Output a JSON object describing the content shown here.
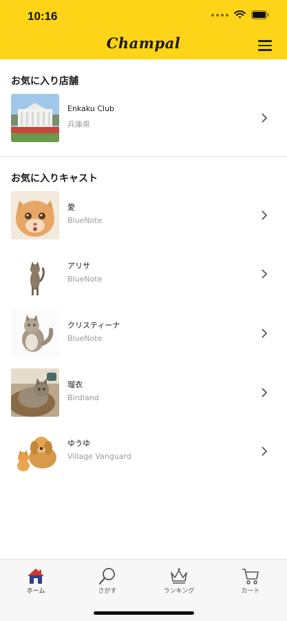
{
  "status": {
    "time": "10:16"
  },
  "header": {
    "logo": "Champal"
  },
  "stores": {
    "title": "お気に入り店舗",
    "items": [
      {
        "name": "Enkaku Club",
        "sub": "兵庫県",
        "image": "white-house-photo"
      }
    ]
  },
  "casts": {
    "title": "お気に入りキャスト",
    "items": [
      {
        "name": "愛",
        "sub": "BlueNote",
        "image": "orange-kitten-photo"
      },
      {
        "name": "アリサ",
        "sub": "BlueNote",
        "image": "standing-kitten-photo"
      },
      {
        "name": "クリスティーナ",
        "sub": "BlueNote",
        "image": "grey-fluffy-cat-photo"
      },
      {
        "name": "瑠衣",
        "sub": "Birdland",
        "image": "tabby-cat-in-basket-photo"
      },
      {
        "name": "ゆうゆ",
        "sub": "Village Vanguard",
        "image": "golden-retriever-and-kitten-photo"
      }
    ]
  },
  "tabbar": {
    "tabs": [
      {
        "label": "ホーム",
        "icon": "home-icon",
        "active": true
      },
      {
        "label": "さがす",
        "icon": "search-icon",
        "active": false
      },
      {
        "label": "ランキング",
        "icon": "crown-icon",
        "active": false
      },
      {
        "label": "カート",
        "icon": "cart-icon",
        "active": false
      }
    ]
  },
  "colors": {
    "brand": "#fdd417",
    "text": "#1a1a1a",
    "subtext": "#9a9a9a",
    "home_red": "#d8322b",
    "home_blue": "#2a3f8f"
  }
}
